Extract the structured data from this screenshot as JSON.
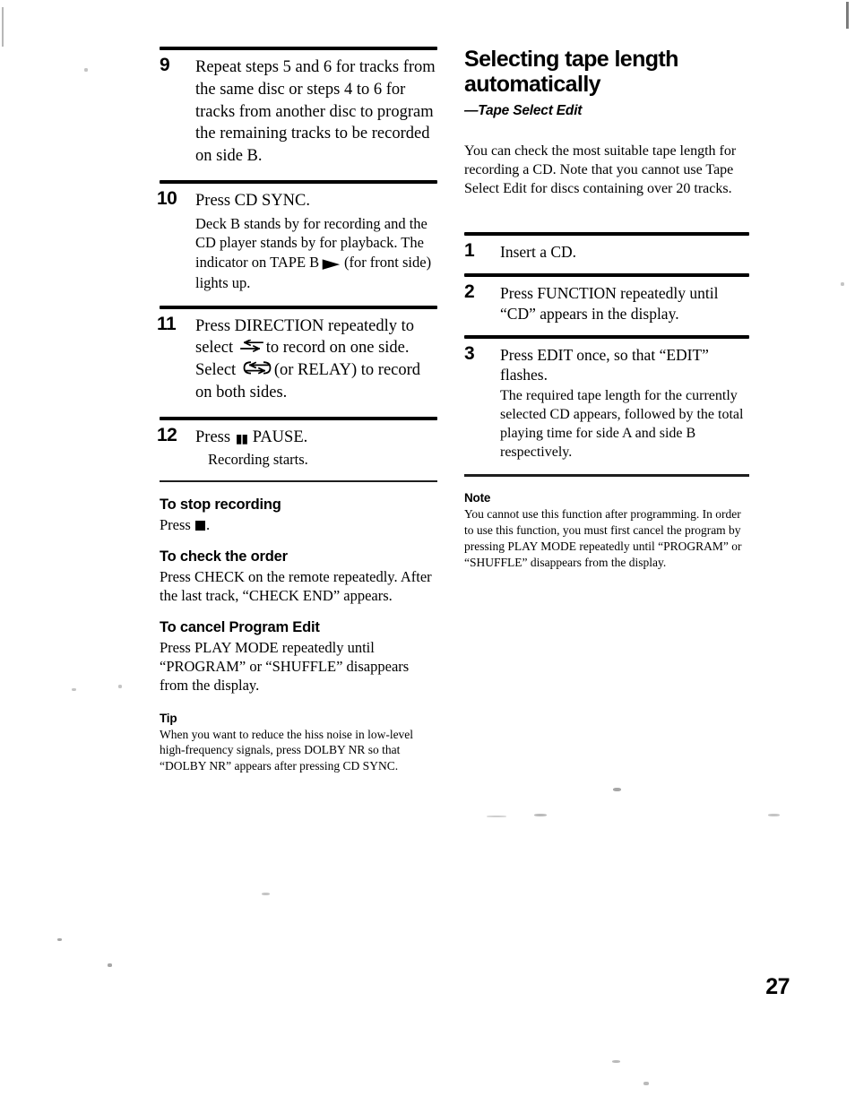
{
  "page": {
    "number": "27"
  },
  "left_column": {
    "steps": [
      {
        "number": "9",
        "lead": "Repeat steps 5 and 6 for tracks from the same disc or steps 4 to 6 for tracks from another disc to program the remaining tracks to be recorded on side B."
      },
      {
        "number": "10",
        "lead": "Press CD SYNC.",
        "body_before_glyph": "Deck B stands by for recording and the CD player stands by for playback. The indicator on TAPE B",
        "glyph": "play-arrow-icon",
        "body_after_glyph": "(for front side) lights up."
      },
      {
        "number": "11",
        "lead_part1": "Press DIRECTION repeatedly to select",
        "glyph1": "one-way-direction-icon",
        "lead_part2": "to record on one side. Select",
        "glyph2": "relay-direction-icon",
        "lead_part3": "(or RELAY) to record on both sides."
      },
      {
        "number": "12",
        "lead_before_glyph": "Press",
        "glyph": "pause-icon",
        "lead_after_glyph": "PAUSE.",
        "body": "Recording starts."
      }
    ],
    "sections": [
      {
        "heading": "To stop recording",
        "text_before_glyph": "Press",
        "glyph": "stop-icon",
        "text_after_glyph": "."
      },
      {
        "heading": "To check the order",
        "text": "Press CHECK on the remote repeatedly. After the last track, “CHECK END” appears."
      },
      {
        "heading": "To cancel Program Edit",
        "text": "Press PLAY MODE repeatedly until “PROGRAM” or “SHUFFLE” disappears from the display."
      },
      {
        "heading": "Tip",
        "text": "When you want to reduce the hiss noise in low-level high-frequency signals, press DOLBY NR so that “DOLBY NR” appears after pressing CD SYNC."
      }
    ]
  },
  "right_column": {
    "title_line1": "Selecting tape length",
    "title_line2": "automatically",
    "subtitle": "—Tape Select Edit",
    "intro": "You can check the most suitable tape length for recording a CD. Note that you cannot use Tape Select Edit for discs containing over 20 tracks.",
    "steps": [
      {
        "number": "1",
        "lead": "Insert a CD."
      },
      {
        "number": "2",
        "lead": "Press FUNCTION repeatedly until “CD” appears in the display."
      },
      {
        "number": "3",
        "lead": "Press EDIT once, so that “EDIT” flashes.",
        "body": "The required tape length for the currently selected CD appears, followed by the total playing time for side A and side B respectively."
      }
    ],
    "note": {
      "heading": "Note",
      "text": "You cannot use this function after programming. In order to use this function, you must first cancel the program by pressing PLAY MODE repeatedly until “PROGRAM” or “SHUFFLE” disappears from the display."
    }
  }
}
